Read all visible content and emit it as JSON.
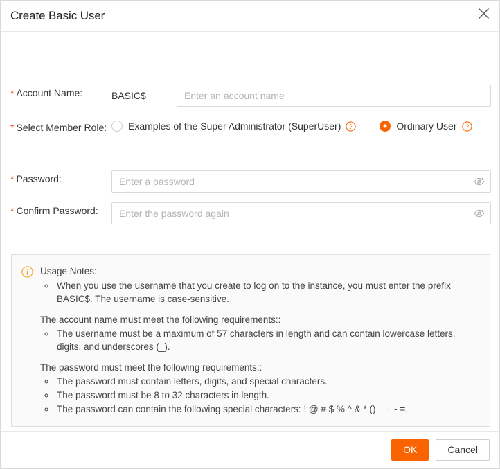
{
  "dialog": {
    "title": "Create Basic User",
    "close_icon": "close-icon"
  },
  "colors": {
    "accent": "#f96400",
    "required_star": "#f5422c",
    "border": "#d9d9d9",
    "notes_bg": "#fafafa",
    "text": "#333333",
    "placeholder": "#b4b4b4"
  },
  "form": {
    "account": {
      "required_mark": "*",
      "label": "Account Name:",
      "prefix": "BASIC$",
      "value": "",
      "placeholder": "Enter an account name"
    },
    "role": {
      "required_mark": "*",
      "label": "Select Member Role:",
      "options": [
        {
          "label": "Examples of the Super Administrator (SuperUser)",
          "selected": false,
          "help_icon": "help-circle-icon"
        },
        {
          "label": "Ordinary User",
          "selected": true,
          "help_icon": "help-circle-icon"
        }
      ]
    },
    "password": {
      "required_mark": "*",
      "label": "Password:",
      "value": "",
      "placeholder": "Enter a password",
      "reveal_icon": "eye-slash-icon"
    },
    "confirm_password": {
      "required_mark": "*",
      "label": "Confirm Password:",
      "value": "",
      "placeholder": "Enter the password again",
      "reveal_icon": "eye-slash-icon"
    }
  },
  "notes": {
    "info_icon": "info-circle-icon",
    "title": "Usage Notes:",
    "first_bullets": [
      "When you use the username that you create to log on to the instance, you must enter the prefix BASIC$. The username is case-sensitive."
    ],
    "account_heading": "The account name must meet the following requirements::",
    "account_bullets": [
      "The username must be a maximum of 57 characters in length and can contain lowercase letters, digits, and underscores (_)."
    ],
    "password_heading": "The password must meet the following requirements::",
    "password_bullets": [
      "The password must contain letters, digits, and special characters.",
      "The password must be 8 to 32 characters in length.",
      "The password can contain the following special characters: ! @ # $ % ^ & * () _ + - =."
    ]
  },
  "footer": {
    "ok_label": "OK",
    "cancel_label": "Cancel"
  }
}
